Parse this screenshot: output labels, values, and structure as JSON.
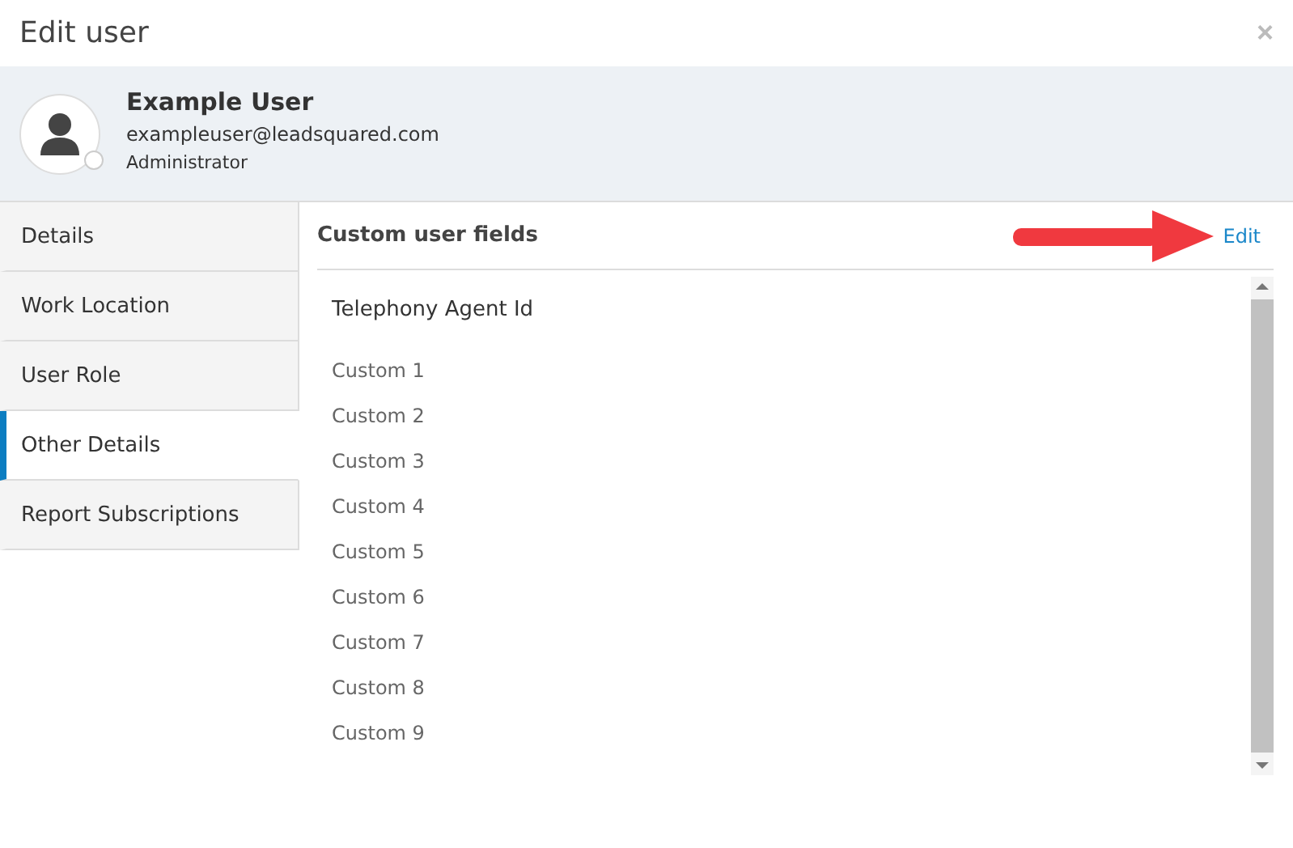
{
  "dialog": {
    "title": "Edit user",
    "close": "×"
  },
  "user": {
    "name": "Example User",
    "email": "exampleuser@leadsquared.com",
    "role": "Administrator",
    "online": false
  },
  "sidebar": {
    "items": [
      {
        "label": "Details",
        "selected": false
      },
      {
        "label": "Work Location",
        "selected": false
      },
      {
        "label": "User Role",
        "selected": false
      },
      {
        "label": "Other Details",
        "selected": true
      },
      {
        "label": "Report Subscriptions",
        "selected": false
      }
    ]
  },
  "panel": {
    "title": "Custom user fields",
    "edit_link": "Edit",
    "fields": [
      {
        "label": "Telephony Agent Id",
        "kind": "heading"
      },
      {
        "label": "Custom 1",
        "kind": "field"
      },
      {
        "label": "Custom 2",
        "kind": "field"
      },
      {
        "label": "Custom 3",
        "kind": "field"
      },
      {
        "label": "Custom 4",
        "kind": "field"
      },
      {
        "label": "Custom 5",
        "kind": "field"
      },
      {
        "label": "Custom 6",
        "kind": "field"
      },
      {
        "label": "Custom 7",
        "kind": "field"
      },
      {
        "label": "Custom 8",
        "kind": "field"
      },
      {
        "label": "Custom 9",
        "kind": "field"
      }
    ]
  }
}
